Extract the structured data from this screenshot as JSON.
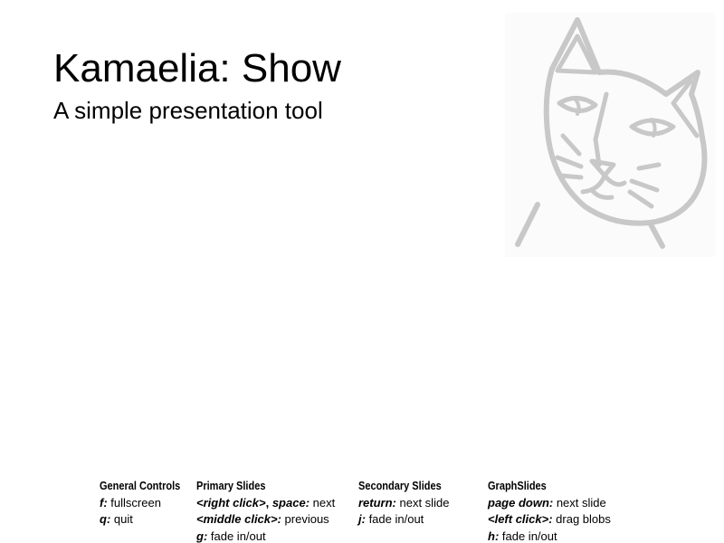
{
  "slide": {
    "title": "Kamaelia: Show",
    "subtitle": "A simple presentation tool",
    "logo_icon": "cat-face-icon",
    "logo_color": "#c8c8c8"
  },
  "help": {
    "general": {
      "header": "General Controls",
      "rows": [
        {
          "key": "f:",
          "desc": " fullscreen"
        },
        {
          "key": "q:",
          "desc": " quit"
        }
      ]
    },
    "primary": {
      "header": "Primary Slides",
      "rows": [
        {
          "key": "<right click>",
          "sep": ", ",
          "key2": "space:",
          "desc": " next"
        },
        {
          "key": "<middle click>:",
          "desc": " previous"
        },
        {
          "key": "g:",
          "desc": " fade in/out"
        }
      ]
    },
    "secondary": {
      "header": "Secondary Slides",
      "rows": [
        {
          "key": "return:",
          "desc": " next slide"
        },
        {
          "key": "j:",
          "desc": " fade in/out"
        }
      ]
    },
    "graph": {
      "header": "GraphSlides",
      "rows": [
        {
          "key": "page down:",
          "desc": " next slide"
        },
        {
          "key": "<left click>:",
          "desc": " drag blobs"
        },
        {
          "key": "h:",
          "desc": " fade in/out"
        }
      ]
    }
  }
}
